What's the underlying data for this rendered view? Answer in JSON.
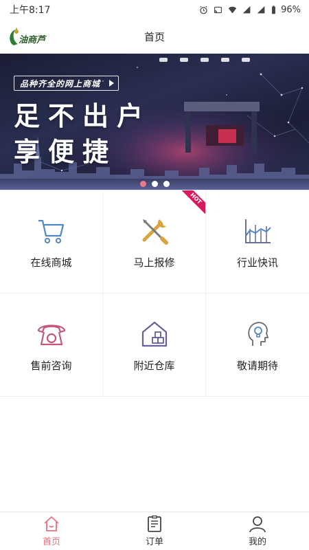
{
  "status_bar": {
    "time": "上午8:17",
    "battery": "96%"
  },
  "header": {
    "logo_icon": "app-logo",
    "title": "首页"
  },
  "banner": {
    "tagline": "品种齐全的网上商城",
    "headline_line1": "足不出户",
    "headline_line2": "享便捷",
    "dots": 3,
    "active_dot": 0
  },
  "grid": {
    "items": [
      {
        "label": "在线商城",
        "icon": "shopping-cart-icon",
        "badge": ""
      },
      {
        "label": "马上报修",
        "icon": "repair-tools-icon",
        "badge": "HOT"
      },
      {
        "label": "行业快讯",
        "icon": "chart-icon",
        "badge": ""
      },
      {
        "label": "售前咨询",
        "icon": "telephone-icon",
        "badge": ""
      },
      {
        "label": "附近仓库",
        "icon": "warehouse-icon",
        "badge": ""
      },
      {
        "label": "敬请期待",
        "icon": "idea-head-icon",
        "badge": ""
      }
    ]
  },
  "tabbar": {
    "tabs": [
      {
        "label": "首页",
        "icon": "home-icon",
        "active": true
      },
      {
        "label": "订单",
        "icon": "order-list-icon",
        "active": false
      },
      {
        "label": "我的",
        "icon": "user-icon",
        "active": false
      }
    ]
  },
  "colors": {
    "accent": "#e8707f",
    "icon_blue": "#4f86c6",
    "hot_badge": "#d81b60",
    "banner_dark": "#1a1d33"
  }
}
